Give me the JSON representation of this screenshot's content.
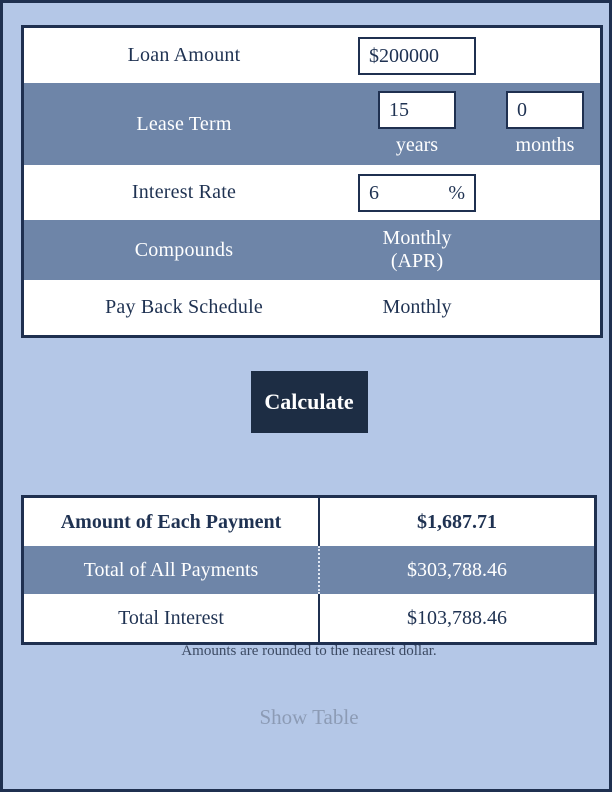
{
  "colors": {
    "page_background": "#b4c7e7",
    "alt_row": "#6e85a8",
    "border": "#1f3050",
    "text": "#1f3252",
    "button_background": "#1d2d44",
    "button_text": "#ffffff",
    "muted_link": "#8c9bb5"
  },
  "inputs": {
    "rows": [
      {
        "label": "Loan Amount",
        "value": "$200000"
      },
      {
        "label": "Lease Term",
        "years_value": "15",
        "years_unit": "years",
        "months_value": "0",
        "months_unit": "months"
      },
      {
        "label": "Interest Rate",
        "value": "6",
        "suffix": "%"
      },
      {
        "label": "Compounds",
        "value_line1": "Monthly",
        "value_line2": "(APR)"
      },
      {
        "label": "Pay Back Schedule",
        "value": "Monthly"
      }
    ]
  },
  "actions": {
    "calculate_label": "Calculate",
    "show_table_label": "Show Table"
  },
  "results": {
    "rows": [
      {
        "label": "Amount of Each Payment",
        "value": "$1,687.71"
      },
      {
        "label": "Total of All Payments",
        "value": "$303,788.46"
      },
      {
        "label": "Total Interest",
        "value": "$103,788.46"
      }
    ]
  },
  "footer": {
    "note": "Amounts are rounded to the nearest dollar."
  }
}
